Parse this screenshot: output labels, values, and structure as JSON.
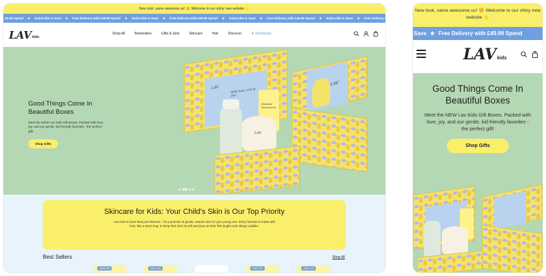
{
  "announcement": {
    "text": "New look, same awesome us! 😊 Welcome to our shiny new website 🌟"
  },
  "ticker": {
    "items": [
      "49.99 Spend",
      "Subscribe & Save",
      "Free Delivery with £49.99 Spend",
      "Subscribe & Save",
      "Free Delivery with £49.99 Spend",
      "Subscribe & Save",
      "Free Delivery with £49.99 Spend",
      "Subscribe & Save",
      "Free Delivery with £49.99 Spend",
      "Subscribe & Save",
      "Free Delivery with £49.99 Spend"
    ],
    "separator": "★",
    "mobile_items": [
      "Save",
      "Free Delivery with £49.99 Spend"
    ]
  },
  "logo": {
    "main": "LAV",
    "sub": "kids"
  },
  "nav": {
    "items": [
      "Shop All",
      "Bestsellers",
      "Gifts & Sets",
      "Skincare",
      "Hair",
      "Discover"
    ],
    "wholesale": "Wholesale",
    "wholesale_icon": "star-icon"
  },
  "header_icons": [
    "search-icon",
    "user-icon",
    "bag-icon"
  ],
  "hero": {
    "title": "Good Things Come In Beautiful Boxes",
    "subtitle": "Meet the NEW Lav Kids Gift Boxes. Packed with love, joy, and our gentle, kid-friendly favorites - the perfect gift!",
    "button": "Shop Gifts",
    "card_text": "With love, a lot of Joy!",
    "tube_text": "Natural Sunscreen",
    "slides": 4,
    "active_slide": 1
  },
  "promo": {
    "title": "Skincare for Kids: Your Child's Skin is Our Top Priority",
    "text": "Lav Kids is more than just skincare - it's a promise of gentle, natural care for your young one. Every formula is made with love, like a warm hug, to keep their skin as soft and pure as their first laughs and sleepy cuddles."
  },
  "best_sellers": {
    "title": "Best Sellers",
    "shop_all": "Shop All",
    "badge": "Value Set"
  },
  "colors": {
    "announce": "#f9ef6b",
    "ticker": "#6f9fe0",
    "hero": "#b4d8b3",
    "lower": "#e8f3fb"
  }
}
